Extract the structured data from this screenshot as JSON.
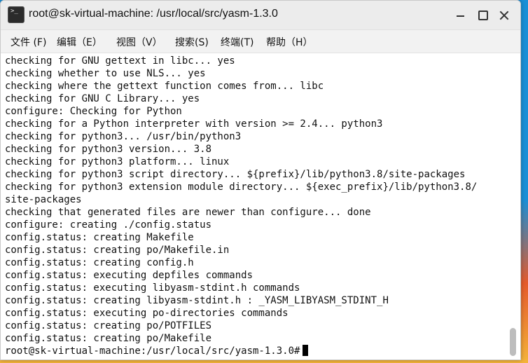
{
  "window": {
    "title": "root@sk-virtual-machine: /usr/local/src/yasm-1.3.0",
    "icon": "terminal-icon"
  },
  "menu": {
    "items": [
      "文件 (F)",
      "编辑（E）",
      "视图（V）",
      "搜索(S)",
      "终端(T)",
      "帮助（H）"
    ]
  },
  "terminal": {
    "lines": [
      "checking for GNU gettext in libc... yes",
      "checking whether to use NLS... yes",
      "checking where the gettext function comes from... libc",
      "checking for GNU C Library... yes",
      "configure: Checking for Python",
      "checking for a Python interpreter with version >= 2.4... python3",
      "checking for python3... /usr/bin/python3",
      "checking for python3 version... 3.8",
      "checking for python3 platform... linux",
      "checking for python3 script directory... ${prefix}/lib/python3.8/site-packages",
      "checking for python3 extension module directory... ${exec_prefix}/lib/python3.8/",
      "site-packages",
      "checking that generated files are newer than configure... done",
      "configure: creating ./config.status",
      "config.status: creating Makefile",
      "config.status: creating po/Makefile.in",
      "config.status: creating config.h",
      "config.status: executing depfiles commands",
      "config.status: executing libyasm-stdint.h commands",
      "config.status: creating libyasm-stdint.h : _YASM_LIBYASM_STDINT_H",
      "config.status: executing po-directories commands",
      "config.status: creating po/POTFILES",
      "config.status: creating po/Makefile"
    ],
    "prompt": "root@sk-virtual-machine:/usr/local/src/yasm-1.3.0#"
  }
}
